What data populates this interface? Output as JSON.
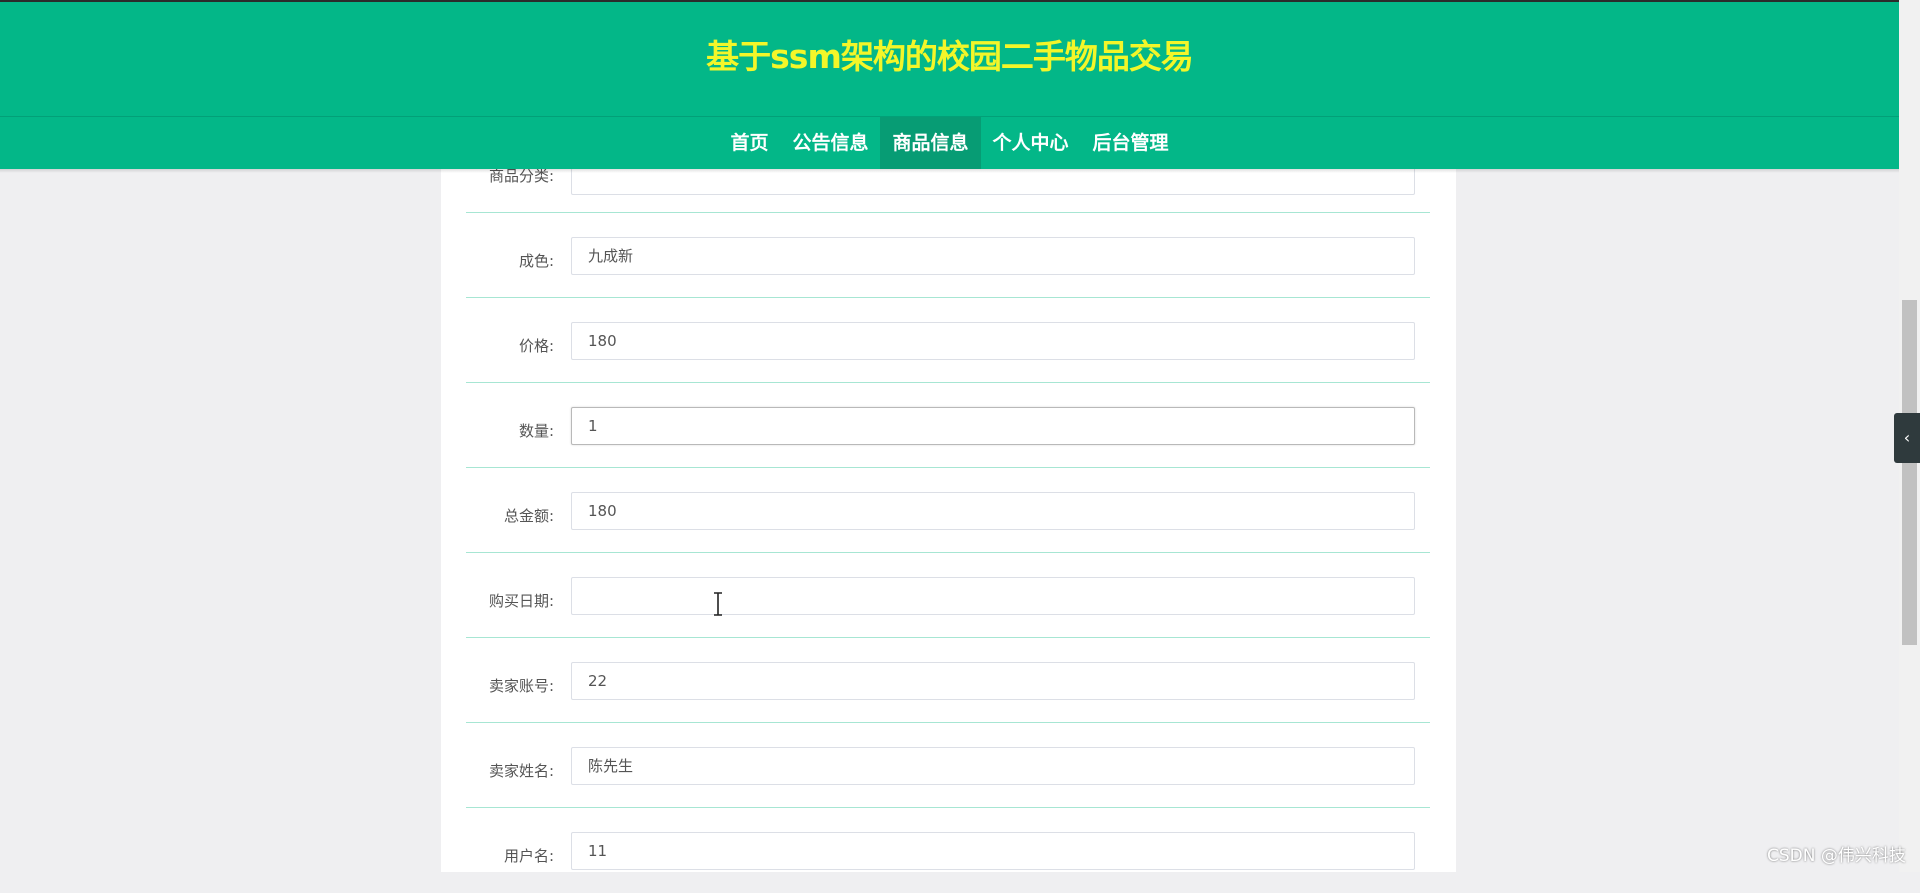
{
  "header": {
    "title": "基于ssm架构的校园二手物品交易",
    "nav": [
      "首页",
      "公告信息",
      "商品信息",
      "个人中心",
      "后台管理"
    ],
    "active_nav": "商品信息"
  },
  "form": {
    "rows": [
      {
        "label": "商品分类:",
        "value": ""
      },
      {
        "label": "成色:",
        "value": "九成新"
      },
      {
        "label": "价格:",
        "value": "180"
      },
      {
        "label": "数量:",
        "value": "1"
      },
      {
        "label": "总金额:",
        "value": "180"
      },
      {
        "label": "购买日期:",
        "value": ""
      },
      {
        "label": "卖家账号:",
        "value": "22"
      },
      {
        "label": "卖家姓名:",
        "value": "陈先生"
      },
      {
        "label": "用户名:",
        "value": "11"
      }
    ]
  },
  "side_tab": {
    "icon": "chevron-left-icon",
    "glyph": "‹"
  },
  "watermark": "CSDN @伟兴科技",
  "colors": {
    "header_bg": "#03b788",
    "title_color": "#f3f629",
    "active_nav_bg": "#079c74",
    "separator": "#a7e6d3"
  }
}
